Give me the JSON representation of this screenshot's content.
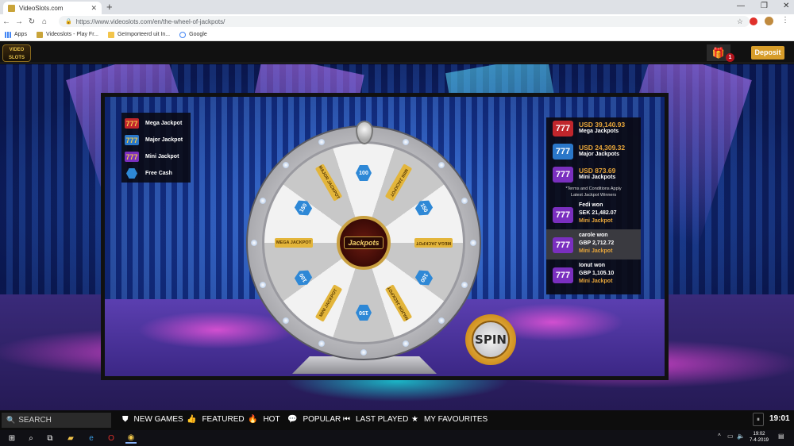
{
  "browser": {
    "tab_title": "VideoSlots.com",
    "url": "https://www.videoslots.com/en/the-wheel-of-jackpots/",
    "bookmarks": [
      {
        "label": "Apps"
      },
      {
        "label": "Videoslots - Play Fr..."
      },
      {
        "label": "Geïmporteerd uit In..."
      },
      {
        "label": "Google"
      }
    ]
  },
  "header": {
    "logo_text": "VIDEO SLOTS",
    "gift_count": "1",
    "deposit_label": "Deposit"
  },
  "legend": [
    {
      "label": "Mega Jackpot",
      "icon": "mega-jackpot-icon",
      "color": "#c0262c"
    },
    {
      "label": "Major Jackpot",
      "icon": "major-jackpot-icon",
      "color": "#2a77c9"
    },
    {
      "label": "Mini Jackpot",
      "icon": "mini-jackpot-icon",
      "color": "#7a2fbf"
    },
    {
      "label": "Free Cash",
      "icon": "free-cash-icon",
      "color": "#2e88d6"
    }
  ],
  "jackpots": [
    {
      "amount": "USD 39,140.93",
      "name": "Mega Jackpots",
      "color": "#c0262c"
    },
    {
      "amount": "USD 24,309.32",
      "name": "Major Jackpots",
      "color": "#2a77c9"
    },
    {
      "amount": "USD 873.69",
      "name": "Mini Jackpots",
      "color": "#7a2fbf"
    }
  ],
  "terms_note": "*Terms and Conditions Apply",
  "latest_winners_title": "Latest Jackpot Winners",
  "winners": [
    {
      "name": "Fedi",
      "won": "won",
      "amount": "SEK 21,482.07",
      "type": "Mini Jackpot",
      "highlight": false
    },
    {
      "name": "carole",
      "won": "won",
      "amount": "GBP 2,712.72",
      "type": "Mini Jackpot",
      "highlight": true
    },
    {
      "name": "Ionut",
      "won": "won",
      "amount": "GBP 1,105.10",
      "type": "Mini Jackpot",
      "highlight": false
    }
  ],
  "wheel": {
    "hub_label": "Jackpots",
    "segments": [
      "100",
      "MINI JACKPOT",
      "150",
      "MEGA JACKPOT",
      "100",
      "MAJOR JACKPOT",
      "150",
      "MINI JACKPOT",
      "100",
      "MEGA JACKPOT",
      "150",
      "MAJOR JACKPOT"
    ]
  },
  "spin_label": "SPIN",
  "game_nav": {
    "search_placeholder": "SEARCH",
    "items": [
      "NEW GAMES",
      "FEATURED",
      "HOT",
      "POPULAR",
      "LAST PLAYED",
      "MY FAVOURITES"
    ],
    "time": "19:01"
  },
  "taskbar": {
    "time": "19:02",
    "date": "7-4-2019"
  }
}
